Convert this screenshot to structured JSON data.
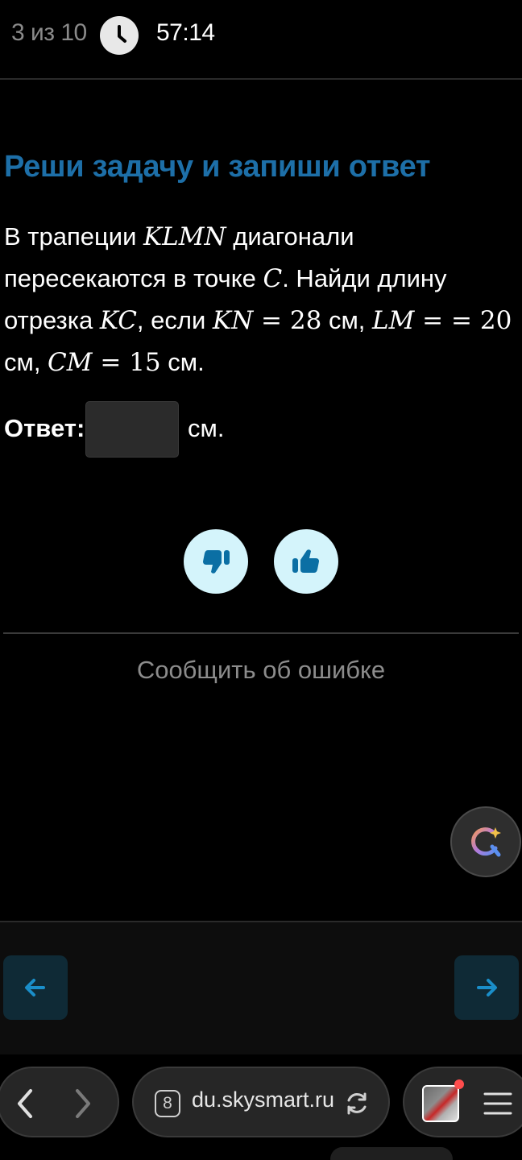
{
  "header": {
    "counter": "3 из 10",
    "timer": "57:14",
    "clock_icon": "clock-icon"
  },
  "task": {
    "title": "Реши задачу и запиши ответ",
    "text": {
      "p1": "В трапеции ",
      "klmn": "KLMN",
      "p2": " диагонали пересекаются в точке ",
      "c": "C",
      "p3": ". Найди длину отрезка ",
      "kc": "KC",
      "p4": ", если ",
      "kn": "KN",
      "eq1": " = 28",
      "u1": " см, ",
      "lm": "LM",
      "eq2": " = = 20",
      "u2": " см, ",
      "cm": "CM",
      "eq3": " = 15",
      "u3": " см."
    },
    "answer_label": "Ответ:",
    "answer_value": "",
    "answer_unit": "см."
  },
  "feedback": {
    "dislike_icon": "thumbs-down-icon",
    "like_icon": "thumbs-up-icon"
  },
  "report_label": "Сообщить об ошибке",
  "ai_button_icon": "ai-assistant-icon",
  "navigation": {
    "prev_icon": "arrow-left-icon",
    "next_icon": "arrow-right-icon"
  },
  "browser": {
    "tab_count": "8",
    "url": "du.skysmart.ru",
    "back_icon": "chevron-left-icon",
    "forward_icon": "chevron-right-icon",
    "reload_icon": "reload-icon",
    "menu_icon": "hamburger-menu-icon"
  },
  "colors": {
    "accent_title": "#1d6fa8",
    "feedback_bg": "#d4f4fb",
    "feedback_icon": "#0b6fa4",
    "nav_bg": "#0f2a36",
    "nav_arrow": "#1a8ec9"
  }
}
